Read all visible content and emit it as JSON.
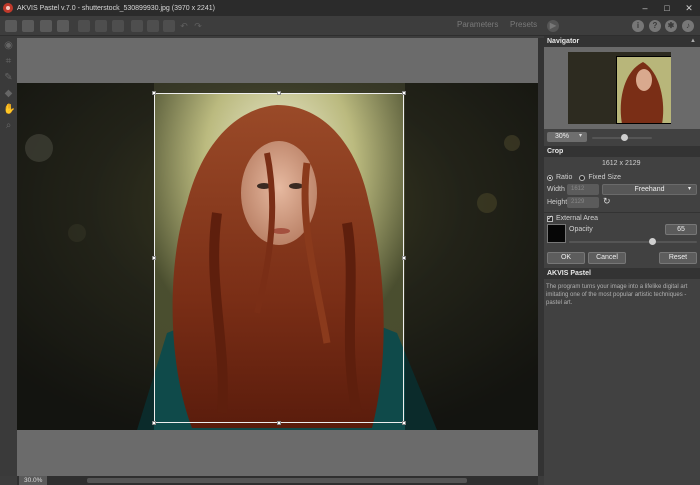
{
  "window": {
    "title": "AKVIS Pastel v.7.0 - shutterstock_530899930.jpg (3970 x 2241)",
    "minimize": "–",
    "maximize": "□",
    "close": "✕"
  },
  "toolbar": {
    "tabs": {
      "parameters": "Parameters",
      "presets": "Presets"
    },
    "run_icon": "play-icon",
    "info_icon": "i",
    "help_icon": "?",
    "settings_icon": "gear-icon",
    "notify_icon": "bell-icon"
  },
  "canvas": {
    "zoom_label": "30.0%"
  },
  "navigator": {
    "title": "Navigator",
    "zoom_value": "30%"
  },
  "crop": {
    "title": "Crop",
    "dimensions": "1612 x 2129",
    "ratio_label": "Ratio",
    "fixed_size_label": "Fixed Size",
    "width_label": "Width",
    "height_label": "Height",
    "width_value": "1612",
    "height_value": "2129",
    "mode_select": "Freehand",
    "external_area_label": "External Area",
    "opacity_label": "Opacity",
    "opacity_value": "65",
    "opacity_fraction": 0.65,
    "swatch_color": "#060606",
    "ok_label": "OK",
    "cancel_label": "Cancel",
    "reset_label": "Reset"
  },
  "about": {
    "title": "AKVIS Pastel",
    "text": "The program turns your image into a lifelike digital art imitating one of the most popular artistic techniques - pastel art."
  }
}
